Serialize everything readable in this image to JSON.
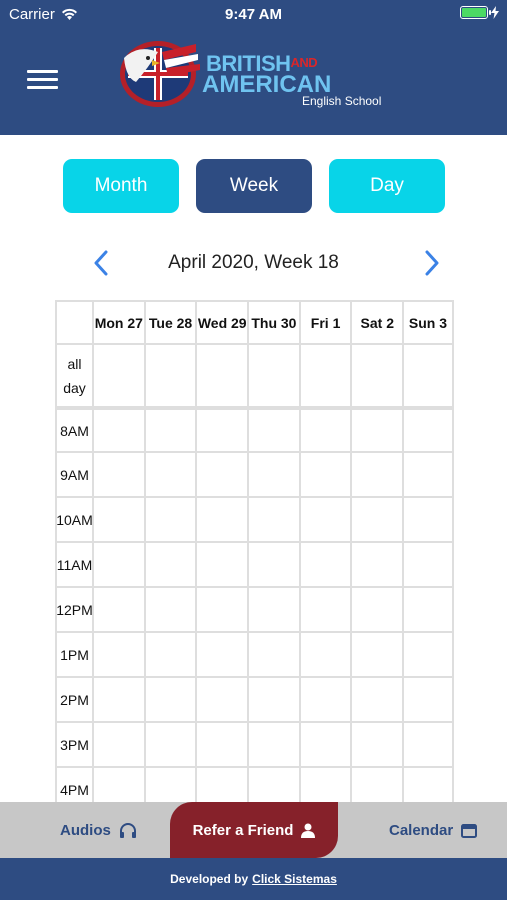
{
  "status_bar": {
    "carrier": "Carrier",
    "time": "9:47 AM"
  },
  "logo": {
    "line1": "BRITISH",
    "and": "AND",
    "line2": "AMERICAN",
    "line3": "English School"
  },
  "view_switch": {
    "month": "Month",
    "week": "Week",
    "day": "Day",
    "selected": "Week"
  },
  "nav": {
    "title": "April 2020, Week 18"
  },
  "calendar": {
    "days": [
      "Mon 27",
      "Tue 28",
      "Wed 29",
      "Thu 30",
      "Fri 1",
      "Sat 2",
      "Sun 3"
    ],
    "all_day_label": "all day",
    "hours": [
      "8AM",
      "9AM",
      "10AM",
      "11AM",
      "12PM",
      "1PM",
      "2PM",
      "3PM",
      "4PM"
    ]
  },
  "tabbar": {
    "audios": "Audios",
    "refer": "Refer a Friend",
    "calendar": "Calendar"
  },
  "footer": {
    "prefix": "Developed by",
    "link": "Click Sistemas"
  },
  "colors": {
    "primary": "#2e4c82",
    "accent": "#08d4e8",
    "refer": "#86212a",
    "tabbar": "#c7c7c7"
  }
}
